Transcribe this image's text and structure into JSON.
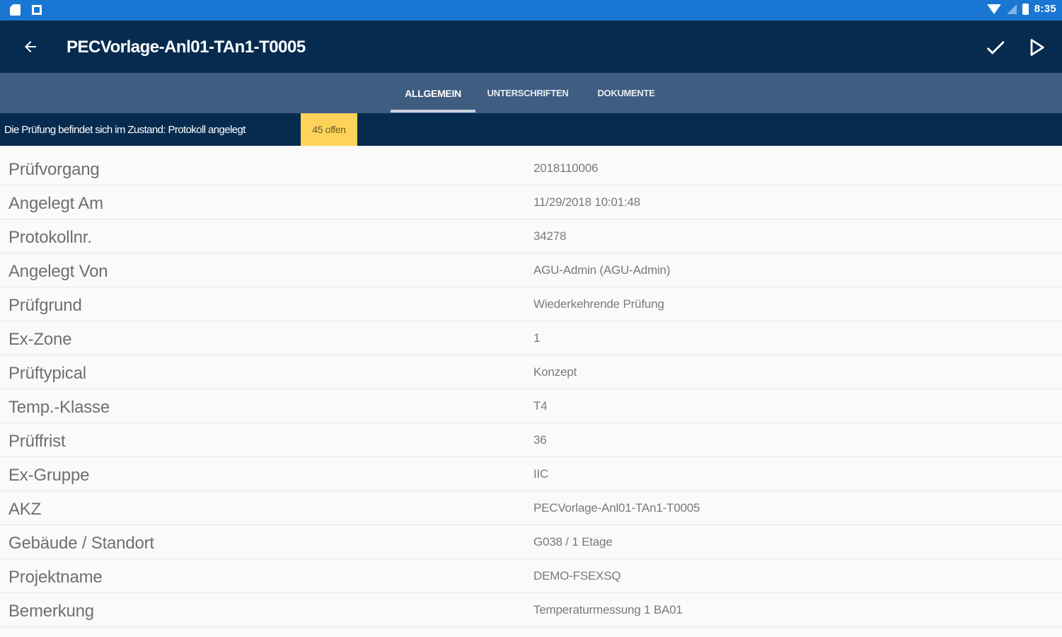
{
  "statusbar": {
    "time": "8:35",
    "icons": [
      "sd-card-icon",
      "notification-square-icon",
      "wifi-icon",
      "signal-icon",
      "battery-icon"
    ]
  },
  "toolbar": {
    "title": "PECVorlage-Anl01-TAn1-T0005",
    "back_icon": "arrow-back-icon",
    "confirm_icon": "checkmark-icon",
    "run_icon": "play-icon"
  },
  "tabs": [
    {
      "label": "ALLGEMEIN",
      "active": true
    },
    {
      "label": "UNTERSCHRIFTEN",
      "active": false
    },
    {
      "label": "DOKUMENTE",
      "active": false
    }
  ],
  "state": {
    "message": "Die Prüfung befindet sich im Zustand: Protokoll angelegt",
    "badge": "45 offen"
  },
  "details": [
    {
      "label": "Prüfvorgang",
      "value": "2018110006"
    },
    {
      "label": "Angelegt Am",
      "value": "11/29/2018 10:01:48"
    },
    {
      "label": "Protokollnr.",
      "value": "34278"
    },
    {
      "label": "Angelegt Von",
      "value": "AGU-Admin (AGU-Admin)"
    },
    {
      "label": "Prüfgrund",
      "value": "Wiederkehrende Prüfung"
    },
    {
      "label": "Ex-Zone",
      "value": "1"
    },
    {
      "label": "Prüftypical",
      "value": "Konzept"
    },
    {
      "label": "Temp.-Klasse",
      "value": "T4"
    },
    {
      "label": "Prüffrist",
      "value": "36"
    },
    {
      "label": "Ex-Gruppe",
      "value": "IIC"
    },
    {
      "label": "AKZ",
      "value": "PECVorlage-Anl01-TAn1-T0005"
    },
    {
      "label": "Gebäude / Standort",
      "value": "G038 / 1 Etage"
    },
    {
      "label": "Projektname",
      "value": "DEMO-FSEXSQ"
    },
    {
      "label": "Bemerkung",
      "value": "Temperaturmessung 1 BA01"
    }
  ],
  "colors": {
    "statusbar": "#1976d2",
    "toolbar": "#062b4f",
    "tabbar": "#3f5d80",
    "badge": "#fdd35a"
  }
}
